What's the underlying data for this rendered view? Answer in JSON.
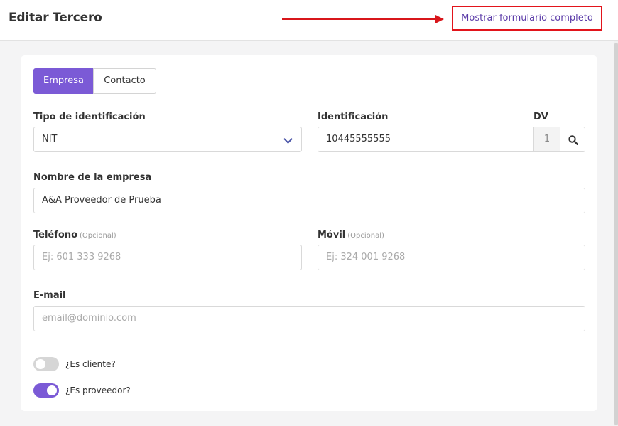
{
  "header": {
    "title": "Editar Tercero",
    "show_full_form_label": "Mostrar formulario completo"
  },
  "tabs": [
    {
      "label": "Empresa",
      "active": true
    },
    {
      "label": "Contacto",
      "active": false
    }
  ],
  "form": {
    "id_type": {
      "label": "Tipo de identificación",
      "value": "NIT"
    },
    "identification": {
      "label": "Identificación",
      "value": "10445555555"
    },
    "dv": {
      "label": "DV",
      "value": "1"
    },
    "company_name": {
      "label": "Nombre de la empresa",
      "value": "A&A Proveedor de Prueba"
    },
    "phone": {
      "label": "Teléfono",
      "optional": "(Opcional)",
      "placeholder": "Ej: 601 333 9268"
    },
    "mobile": {
      "label": "Móvil",
      "optional": "(Opcional)",
      "placeholder": "Ej: 324 001 9268"
    },
    "email": {
      "label": "E-mail",
      "placeholder": "email@dominio.com"
    },
    "is_client": {
      "label": "¿Es cliente?",
      "checked": false
    },
    "is_provider": {
      "label": "¿Es proveedor?",
      "checked": true
    }
  },
  "colors": {
    "accent": "#7b5ad6",
    "highlight_red": "#e2141b",
    "link_purple": "#5b3ba8"
  },
  "icons": {
    "search": "search-icon",
    "dropdown": "chevron-down-icon"
  }
}
